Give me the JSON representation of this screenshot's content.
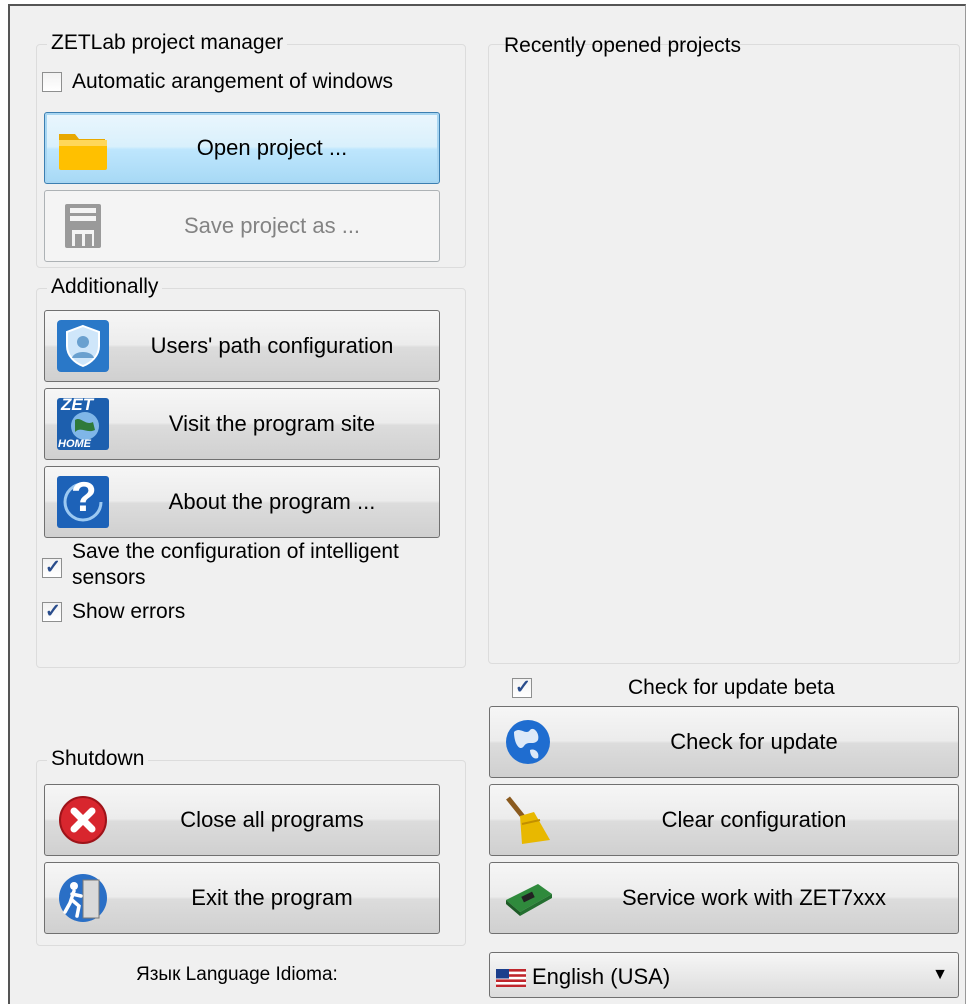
{
  "project_manager": {
    "legend": "ZETLab project manager",
    "auto_arrange": {
      "label": "Automatic arangement of windows",
      "checked": false
    },
    "open_label": "Open project ...",
    "save_label": "Save project as ..."
  },
  "recent": {
    "legend": "Recently opened projects",
    "items": []
  },
  "additionally": {
    "legend": "Additionally",
    "users_path_label": "Users' path configuration",
    "visit_site_label": "Visit the program site",
    "about_label": "About the program ...",
    "save_sensors": {
      "label_line1": "Save the configuration of intelligent",
      "label_line2": "sensors",
      "checked": true
    },
    "show_errors": {
      "label": "Show errors",
      "checked": true
    }
  },
  "update": {
    "beta": {
      "label": "Check for update beta",
      "checked": true
    },
    "check_label": "Check for update",
    "clear_label": "Clear configuration",
    "service_label": "Service work with ZET7xxx"
  },
  "shutdown": {
    "legend": "Shutdown",
    "close_all_label": "Close all programs",
    "exit_label": "Exit the program"
  },
  "language": {
    "label": "Язык Language Idioma:",
    "selected": "English (USA)"
  },
  "icons": {
    "checkmark": "✓",
    "dropdown": "▼",
    "zet_badge": "ZET",
    "home_badge": "HOME",
    "question": "?"
  }
}
